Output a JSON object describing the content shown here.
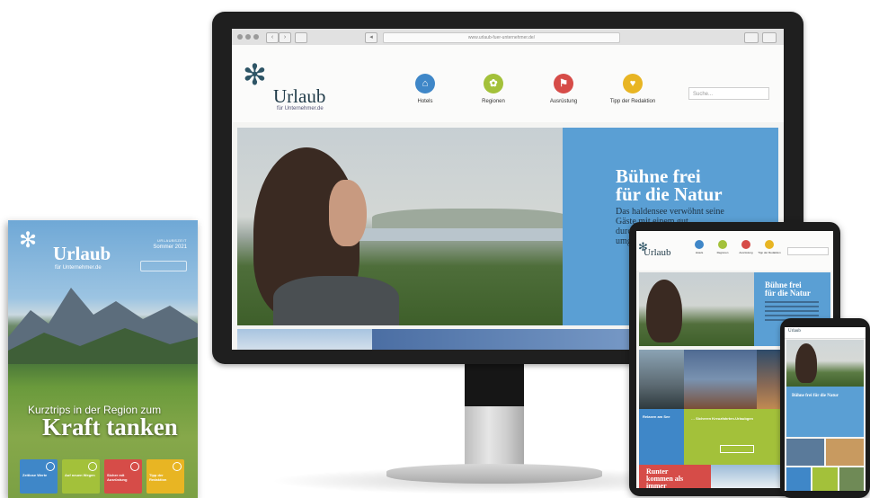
{
  "magazine": {
    "logo_text": "Urlaub",
    "logo_sub": "für Unternehmer.de",
    "issue_label": "URLAUBSZEIT",
    "issue_season": "Sommer 2021",
    "kicker": "Kurztrips in der Region zum",
    "headline": "Kraft tanken",
    "tiles": [
      {
        "label": "Zeitlose Werte",
        "color": "#3f87c8"
      },
      {
        "label": "Auf neuen Wegen",
        "color": "#a3c13a"
      },
      {
        "label": "Sicher mit Ausrüstung",
        "color": "#d64c48"
      },
      {
        "label": "Tipp der Redaktion",
        "color": "#e8b523"
      }
    ]
  },
  "monitor": {
    "browser": {
      "url": "www.urlaub-fuer-unternehmer.de/"
    },
    "site": {
      "logo_text": "Urlaub",
      "logo_sub": "für Unternehmer.de",
      "nav": [
        {
          "label": "Hotels",
          "icon": "hotel-icon",
          "glyph": "⌂",
          "color": "#3f87c8"
        },
        {
          "label": "Regionen",
          "icon": "regions-icon",
          "glyph": "✿",
          "color": "#a3c13a"
        },
        {
          "label": "Ausrüstung",
          "icon": "boot-icon",
          "glyph": "⚑",
          "color": "#d64c48"
        },
        {
          "label": "Tipp der Redaktion",
          "icon": "heart-icon",
          "glyph": "♥",
          "color": "#e8b523"
        }
      ],
      "search_placeholder": "Suche...",
      "hero": {
        "title_line1": "Bühne frei",
        "title_line2": "für die Natur",
        "text": "Das haldensee verwöhnt seine Gäste mit einem gut durchdachten Konzept, das die umgebende Natur bis m..."
      }
    }
  },
  "tablet": {
    "logo_text": "Urlaub",
    "nav": [
      {
        "label": "Hotels",
        "color": "#3f87c8"
      },
      {
        "label": "Regionen",
        "color": "#a3c13a"
      },
      {
        "label": "Ausrüstung",
        "color": "#d64c48"
      },
      {
        "label": "Tipp der Redaktion",
        "color": "#e8b523"
      }
    ],
    "hero_title_line1": "Bühne frei",
    "hero_title_line2": "für die Natur",
    "blue_card": "Relaxen am See",
    "green_card": "… Sicheren Kreuzfahrten-Urlaubgen",
    "red_title_line1": "Runter",
    "red_title_line2": "kommen als",
    "red_title_line3": "immer"
  },
  "phone": {
    "logo_text": "Urlaub",
    "hero_title": "Bühne frei für die Natur"
  }
}
